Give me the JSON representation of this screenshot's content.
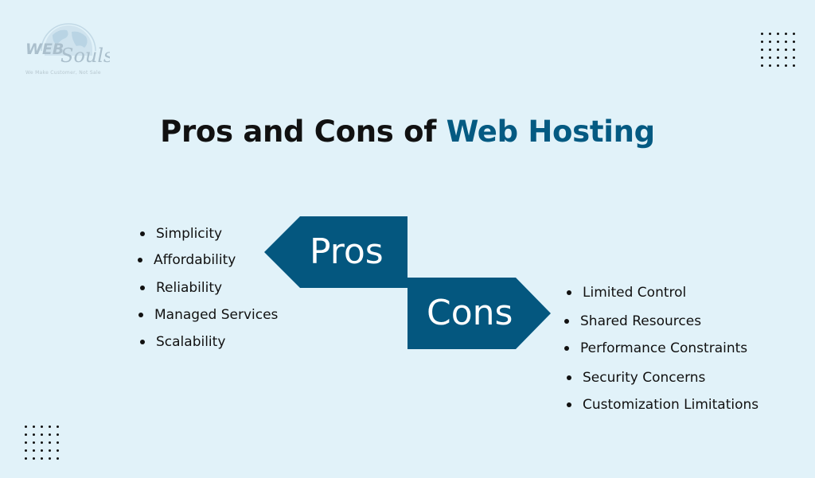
{
  "logo": {
    "brand_left": "WEB",
    "brand_right": "Souls",
    "tagline": "We Make Customer, Not Sale"
  },
  "title": {
    "plain": "Pros and Cons of ",
    "accent": "Web Hosting"
  },
  "colors": {
    "background": "#e1f2f9",
    "accent": "#045a82",
    "shape_fill": "#04577f",
    "text": "#111111"
  },
  "pros": {
    "label": "Pros",
    "items": [
      "Simplicity",
      "Affordability",
      "Reliability",
      "Managed Services",
      "Scalability"
    ]
  },
  "cons": {
    "label": "Cons",
    "items": [
      "Limited Control",
      "Shared Resources",
      "Performance Constraints",
      "Security Concerns",
      "Customization Limitations"
    ]
  }
}
